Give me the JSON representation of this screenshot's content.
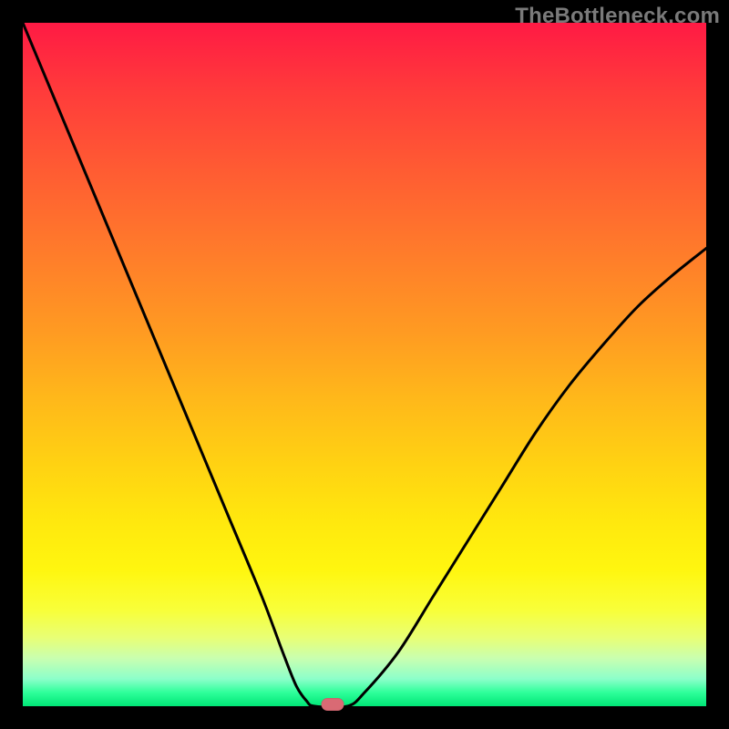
{
  "watermark": "TheBottleneck.com",
  "chart_data": {
    "type": "line",
    "title": "",
    "xlabel": "",
    "ylabel": "",
    "xlim": [
      0,
      100
    ],
    "ylim": [
      0,
      100
    ],
    "background_gradient": {
      "top_color": "#ff1a44",
      "mid_color": "#ffd312",
      "bottom_color": "#00e676",
      "meaning": "red = high bottleneck, green = low bottleneck"
    },
    "left_branch": {
      "x": [
        0,
        5,
        10,
        15,
        20,
        25,
        30,
        35,
        38,
        40,
        41.5,
        42.7
      ],
      "y": [
        100,
        88,
        76,
        64,
        52,
        40,
        28,
        16,
        8,
        3,
        0.8,
        0
      ]
    },
    "flat_segment": {
      "x": [
        42.7,
        47.5
      ],
      "y": [
        0,
        0
      ]
    },
    "right_branch": {
      "x": [
        47.5,
        50,
        55,
        60,
        65,
        70,
        75,
        80,
        85,
        90,
        95,
        100
      ],
      "y": [
        0,
        2,
        8,
        16,
        24,
        32,
        40,
        47,
        53,
        58.5,
        63,
        67
      ]
    },
    "marker": {
      "x": 45.3,
      "y": 0,
      "color": "#d96a74",
      "shape": "pill"
    }
  }
}
